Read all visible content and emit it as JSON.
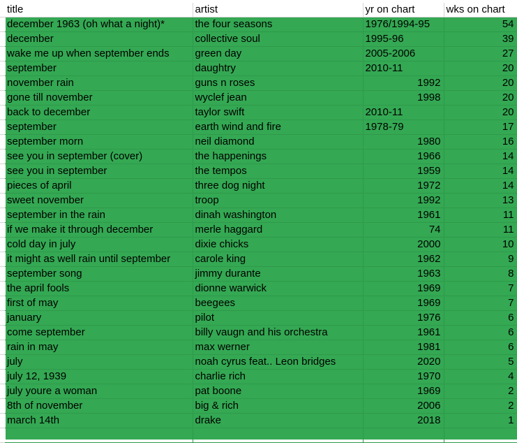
{
  "sheet": {
    "fill_color": "#34a853",
    "headers": [
      "title",
      "artist",
      "yr on chart",
      "wks on chart"
    ],
    "rows": [
      {
        "title": "december 1963 (oh what a night)*",
        "artist": "the four seasons",
        "yr": "1976/1994-95",
        "yr_numeric": false,
        "wks": "54"
      },
      {
        "title": "december",
        "artist": "collective soul",
        "yr": "1995-96",
        "yr_numeric": false,
        "wks": "39"
      },
      {
        "title": "wake me up when september ends",
        "artist": "green day",
        "yr": "2005-2006",
        "yr_numeric": false,
        "wks": "27"
      },
      {
        "title": "september",
        "artist": "daughtry",
        "yr": "2010-11",
        "yr_numeric": false,
        "wks": "20"
      },
      {
        "title": "november rain",
        "artist": "guns n roses",
        "yr": "1992",
        "yr_numeric": true,
        "wks": "20"
      },
      {
        "title": "gone till november",
        "artist": "wyclef jean",
        "yr": "1998",
        "yr_numeric": true,
        "wks": "20"
      },
      {
        "title": "back to december",
        "artist": "taylor swift",
        "yr": "2010-11",
        "yr_numeric": false,
        "wks": "20"
      },
      {
        "title": "september",
        "artist": "earth wind and fire",
        "yr": "1978-79",
        "yr_numeric": false,
        "wks": "17"
      },
      {
        "title": "september morn",
        "artist": "neil diamond",
        "yr": "1980",
        "yr_numeric": true,
        "wks": "16"
      },
      {
        "title": "see you in september (cover)",
        "artist": "the happenings",
        "yr": "1966",
        "yr_numeric": true,
        "wks": "14"
      },
      {
        "title": "see you in september",
        "artist": "the tempos",
        "yr": "1959",
        "yr_numeric": true,
        "wks": "14"
      },
      {
        "title": "pieces of april",
        "artist": "three dog night",
        "yr": "1972",
        "yr_numeric": true,
        "wks": "14"
      },
      {
        "title": "sweet november",
        "artist": "troop",
        "yr": "1992",
        "yr_numeric": true,
        "wks": "13"
      },
      {
        "title": "september in the rain",
        "artist": "dinah washington",
        "yr": "1961",
        "yr_numeric": true,
        "wks": "11"
      },
      {
        "title": "if we make it through december",
        "artist": "merle haggard",
        "yr": "74",
        "yr_numeric": true,
        "wks": "11"
      },
      {
        "title": "cold day in july",
        "artist": "dixie chicks",
        "yr": "2000",
        "yr_numeric": true,
        "wks": "10"
      },
      {
        "title": "it might as well rain until september",
        "artist": "carole king",
        "yr": "1962",
        "yr_numeric": true,
        "wks": "9"
      },
      {
        "title": "september song",
        "artist": "jimmy durante",
        "yr": "1963",
        "yr_numeric": true,
        "wks": "8"
      },
      {
        "title": "the april fools",
        "artist": "dionne warwick",
        "yr": "1969",
        "yr_numeric": true,
        "wks": "7"
      },
      {
        "title": "first of may",
        "artist": "beegees",
        "yr": "1969",
        "yr_numeric": true,
        "wks": "7"
      },
      {
        "title": "january",
        "artist": "pilot",
        "yr": "1976",
        "yr_numeric": true,
        "wks": "6"
      },
      {
        "title": "come september",
        "artist": "billy vaugn and his orchestra",
        "yr": "1961",
        "yr_numeric": true,
        "wks": "6"
      },
      {
        "title": "rain in may",
        "artist": "max werner",
        "yr": "1981",
        "yr_numeric": true,
        "wks": "6"
      },
      {
        "title": "july",
        "artist": "noah cyrus feat.. Leon bridges",
        "yr": "2020",
        "yr_numeric": true,
        "wks": "5"
      },
      {
        "title": "july 12, 1939",
        "artist": "charlie rich",
        "yr": "1970",
        "yr_numeric": true,
        "wks": "4"
      },
      {
        "title": "july youre a woman",
        "artist": "pat boone",
        "yr": "1969",
        "yr_numeric": true,
        "wks": "2"
      },
      {
        "title": "8th of november",
        "artist": "big & rich",
        "yr": "2006",
        "yr_numeric": true,
        "wks": "2"
      },
      {
        "title": "march 14th",
        "artist": "drake",
        "yr": "2018",
        "yr_numeric": true,
        "wks": "1"
      },
      {
        "title": "",
        "artist": "",
        "yr": "",
        "yr_numeric": false,
        "wks": ""
      }
    ]
  }
}
